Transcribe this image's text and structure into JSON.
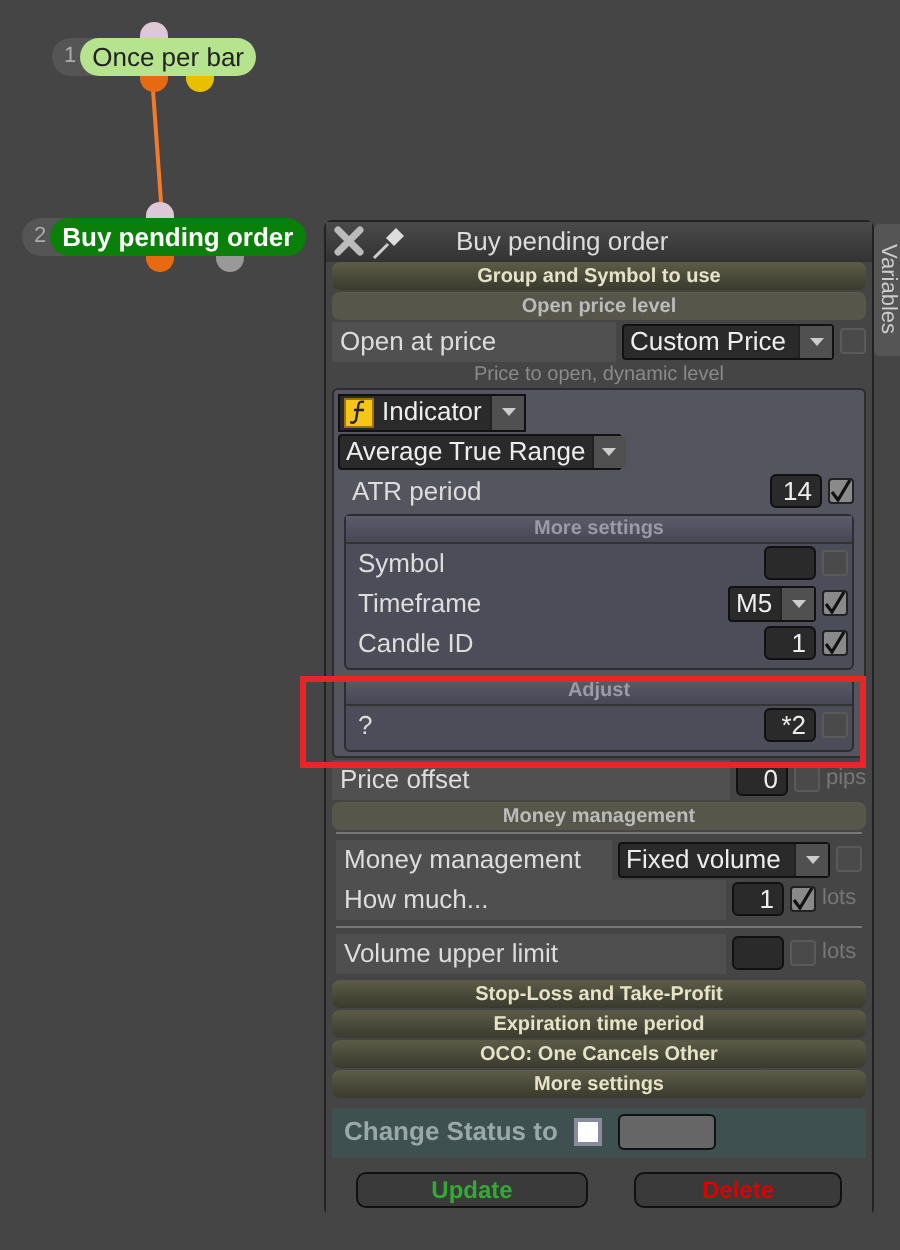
{
  "nodes": [
    {
      "number": "1",
      "label": "Once per bar",
      "kind": "filter"
    },
    {
      "number": "2",
      "label": "Buy pending order",
      "kind": "action"
    }
  ],
  "variables_tab": "Variables",
  "dialog": {
    "title": "Buy pending order",
    "group_header": "Group and Symbol to use",
    "open_price": {
      "header": "Open price level",
      "label": "Open at price",
      "value": "Custom Price",
      "checked": false
    },
    "dynamic_caption": "Price to open, dynamic level",
    "indicator": {
      "value": "Indicator"
    },
    "indicator_type": {
      "value": "Average True Range"
    },
    "atr": {
      "label": "ATR period",
      "value": "14",
      "checked": true
    },
    "more_settings": {
      "header": "More settings",
      "rows": [
        {
          "kind": "text",
          "label": "Symbol",
          "checked": false
        },
        {
          "kind": "dropdown",
          "label": "Timeframe",
          "value": "M5",
          "checked": true
        },
        {
          "kind": "text",
          "label": "Candle ID",
          "value": "1",
          "checked": true
        }
      ]
    },
    "adjust": {
      "header": "Adjust",
      "rows": [
        {
          "kind": "text",
          "label": "?",
          "value": "*2",
          "checked": false
        }
      ]
    },
    "price_offset": {
      "label": "Price offset",
      "value": "0",
      "checked": false,
      "unit": "pips"
    },
    "money": {
      "header": "Money management",
      "groups": [
        [
          {
            "kind": "dropdown",
            "label": "Money management",
            "value": "Fixed volume",
            "checked": false
          },
          {
            "kind": "text",
            "label": "How much...",
            "value": "1",
            "checked": true,
            "unit": "lots"
          }
        ],
        [
          {
            "kind": "text",
            "label": "Volume upper limit",
            "checked": false,
            "unit": "lots"
          }
        ]
      ]
    },
    "collapsed_sections": [
      "Stop-Loss and Take-Profit",
      "Expiration time period",
      "OCO: One Cancels Other",
      "More settings"
    ],
    "change_status": {
      "label": "Change Status to",
      "checked": false
    },
    "buttons": [
      {
        "label": "Update",
        "kind": "update"
      },
      {
        "label": "Delete",
        "kind": "delete"
      }
    ]
  }
}
